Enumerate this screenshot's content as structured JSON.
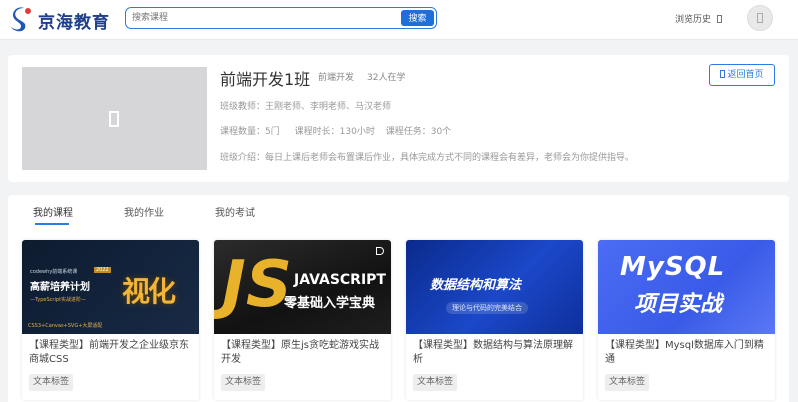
{
  "header": {
    "logo_text": "京海教育",
    "search_placeholder": "搜索课程",
    "search_button": "搜索",
    "history_label": "浏览历史",
    "history_icon": "box-icon"
  },
  "class_info": {
    "title": "前端开发1班",
    "tag": "前端开发",
    "student_count": "32人在学",
    "teachers_label": "班级教师：",
    "teachers": "王刚老师、李明老师、马汉老师",
    "courses_label": "课程数量：",
    "courses_value": "5门",
    "duration_label": "课程时长：",
    "duration_value": "130小时",
    "tasks_label": "课程任务：",
    "tasks_value": "30个",
    "intro_label": "班级介绍：",
    "intro": "每日上课后老师会布置课后作业，具体完成方式不同的课程会有差异，老师会为你提供指导。",
    "back_button": "返回首页"
  },
  "tabs": [
    {
      "label": "我的课程",
      "active": true
    },
    {
      "label": "我的作业",
      "active": false
    },
    {
      "label": "我的考试",
      "active": false
    }
  ],
  "courses": [
    {
      "name": "【课程类型】前端开发之企业级京东商城CSS",
      "label": "文本标签",
      "thumb": {
        "line1": "codewhy前端系统课",
        "badge": "2022",
        "line2": "高薪培养计划",
        "line3": "—TypeScript实战进阶—",
        "line4": "CSS3+Canvas+SVG+大屏适配",
        "big": "视化"
      }
    },
    {
      "name": "【课程类型】原生js贪吃蛇游戏实战开发",
      "label": "文本标签",
      "thumb": {
        "big": "JS",
        "line1": "JAVASCRIPT",
        "line2": "零基础入学宝典"
      }
    },
    {
      "name": "【课程类型】数据结构与算法原理解析",
      "label": "文本标签",
      "thumb": {
        "line1": "数据结构和算法",
        "line2": "理论与代码的完美结合"
      }
    },
    {
      "name": "【课程类型】Mysql数据库入门到精通",
      "label": "文本标签",
      "thumb": {
        "line1": "MySQL",
        "line2": "项目实战"
      }
    }
  ],
  "colors": {
    "accent": "#2c7be5",
    "brand": "#1f3f8a"
  }
}
